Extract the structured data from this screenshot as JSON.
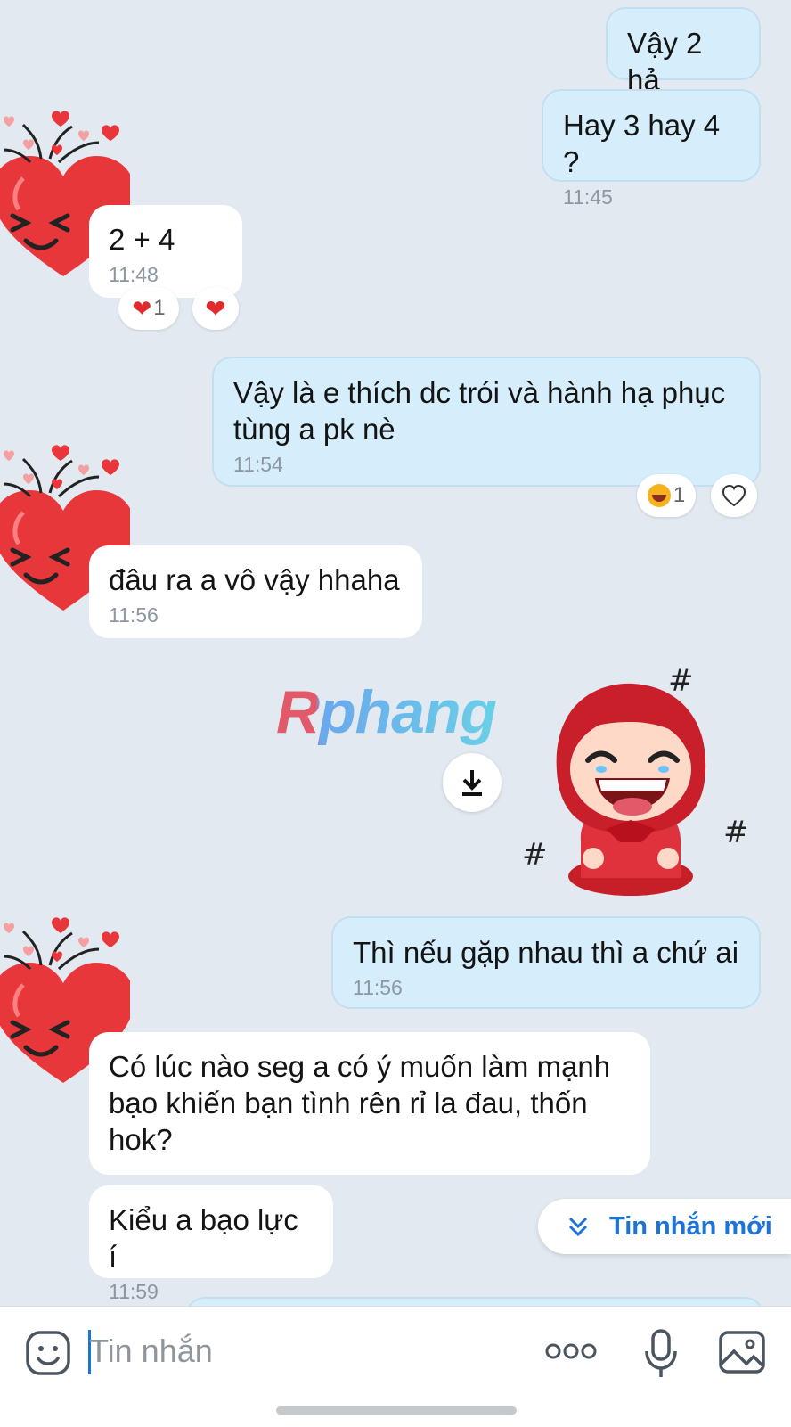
{
  "messages": [
    {
      "text": "Vậy 2 hả"
    },
    {
      "text": "Hay 3 hay 4 ?",
      "time": "11:45"
    },
    {
      "text": "2 + 4",
      "time": "11:48",
      "reaction_count": "1"
    },
    {
      "line1": "Vậy là e thích dc trói và hành hạ phục",
      "line2": "tùng a pk nè",
      "time": "11:54",
      "reaction_count": "1"
    },
    {
      "text": "đâu ra a vô vậy hhaha",
      "time": "11:56"
    },
    {
      "text": "Thì nếu gặp nhau thì a chứ ai",
      "time": "11:56"
    },
    {
      "line1": "Có lúc nào seg a có ý muốn làm mạnh",
      "line2": "bạo khiến bạn tình rên rỉ la đau, thốn",
      "line3": "hok?"
    },
    {
      "text": "Kiểu a bạo lực í",
      "time": "11:59"
    }
  ],
  "watermark": "Rphang",
  "new_messages_label": "Tin nhắn mới",
  "composer": {
    "placeholder": "Tin nhắn"
  },
  "icons": {
    "avatar": "heart-emoji-avatar",
    "sticker": "red-hood-laughing-sticker",
    "download": "download-icon",
    "emoji": "emoji-icon",
    "more": "more-icon",
    "mic": "microphone-icon",
    "image": "image-icon"
  },
  "colors": {
    "background": "#e2e9f1",
    "outgoing_bubble": "#d6eefc",
    "incoming_bubble": "#ffffff",
    "accent": "#1d74d8",
    "heart": "#e8373a"
  }
}
